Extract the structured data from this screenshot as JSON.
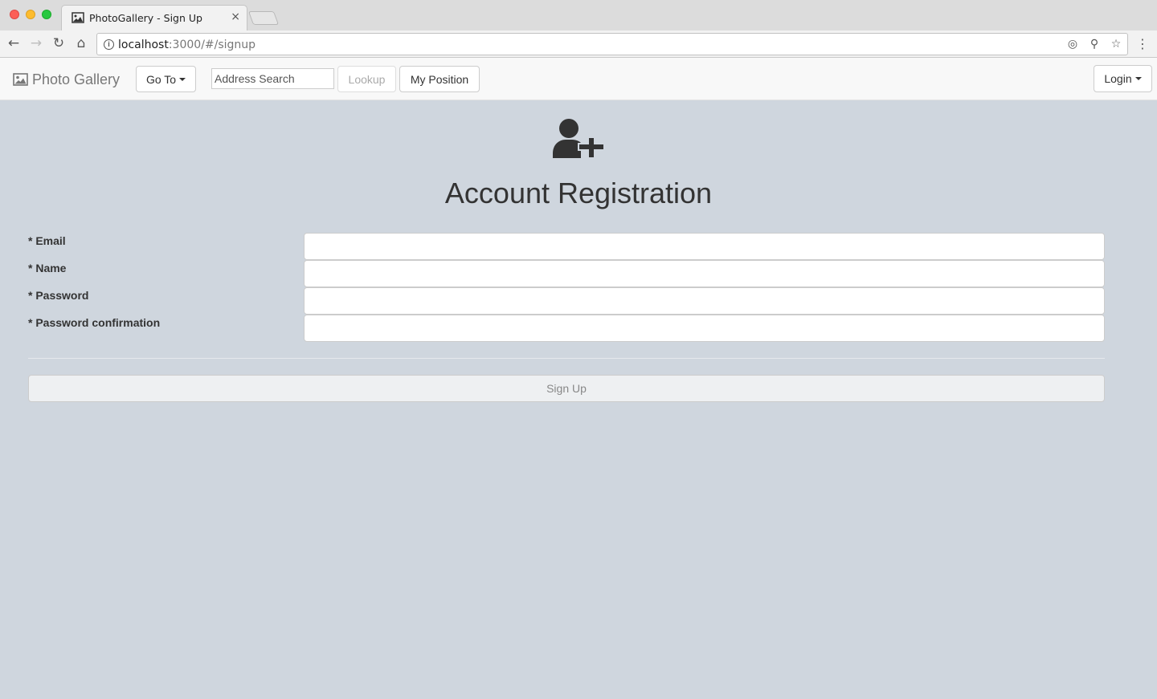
{
  "browser": {
    "tab_title": "PhotoGallery - Sign Up",
    "tab_close": "×",
    "url_host": "localhost",
    "url_path": ":3000/#/signup"
  },
  "navbar": {
    "brand": "Photo Gallery",
    "goto_label": "Go To",
    "address_placeholder": "Address Search",
    "lookup_label": "Lookup",
    "position_label": "My Position",
    "login_label": "Login"
  },
  "page": {
    "title": "Account Registration",
    "icon": "user-plus-icon"
  },
  "form": {
    "fields": [
      {
        "label": "* Email",
        "value": ""
      },
      {
        "label": "* Name",
        "value": ""
      },
      {
        "label": "* Password",
        "value": ""
      },
      {
        "label": "* Password confirmation",
        "value": ""
      }
    ],
    "submit_label": "Sign Up"
  },
  "colors": {
    "page_background": "#cfd6de",
    "navbar_background": "#f8f8f8",
    "text": "#333333"
  }
}
